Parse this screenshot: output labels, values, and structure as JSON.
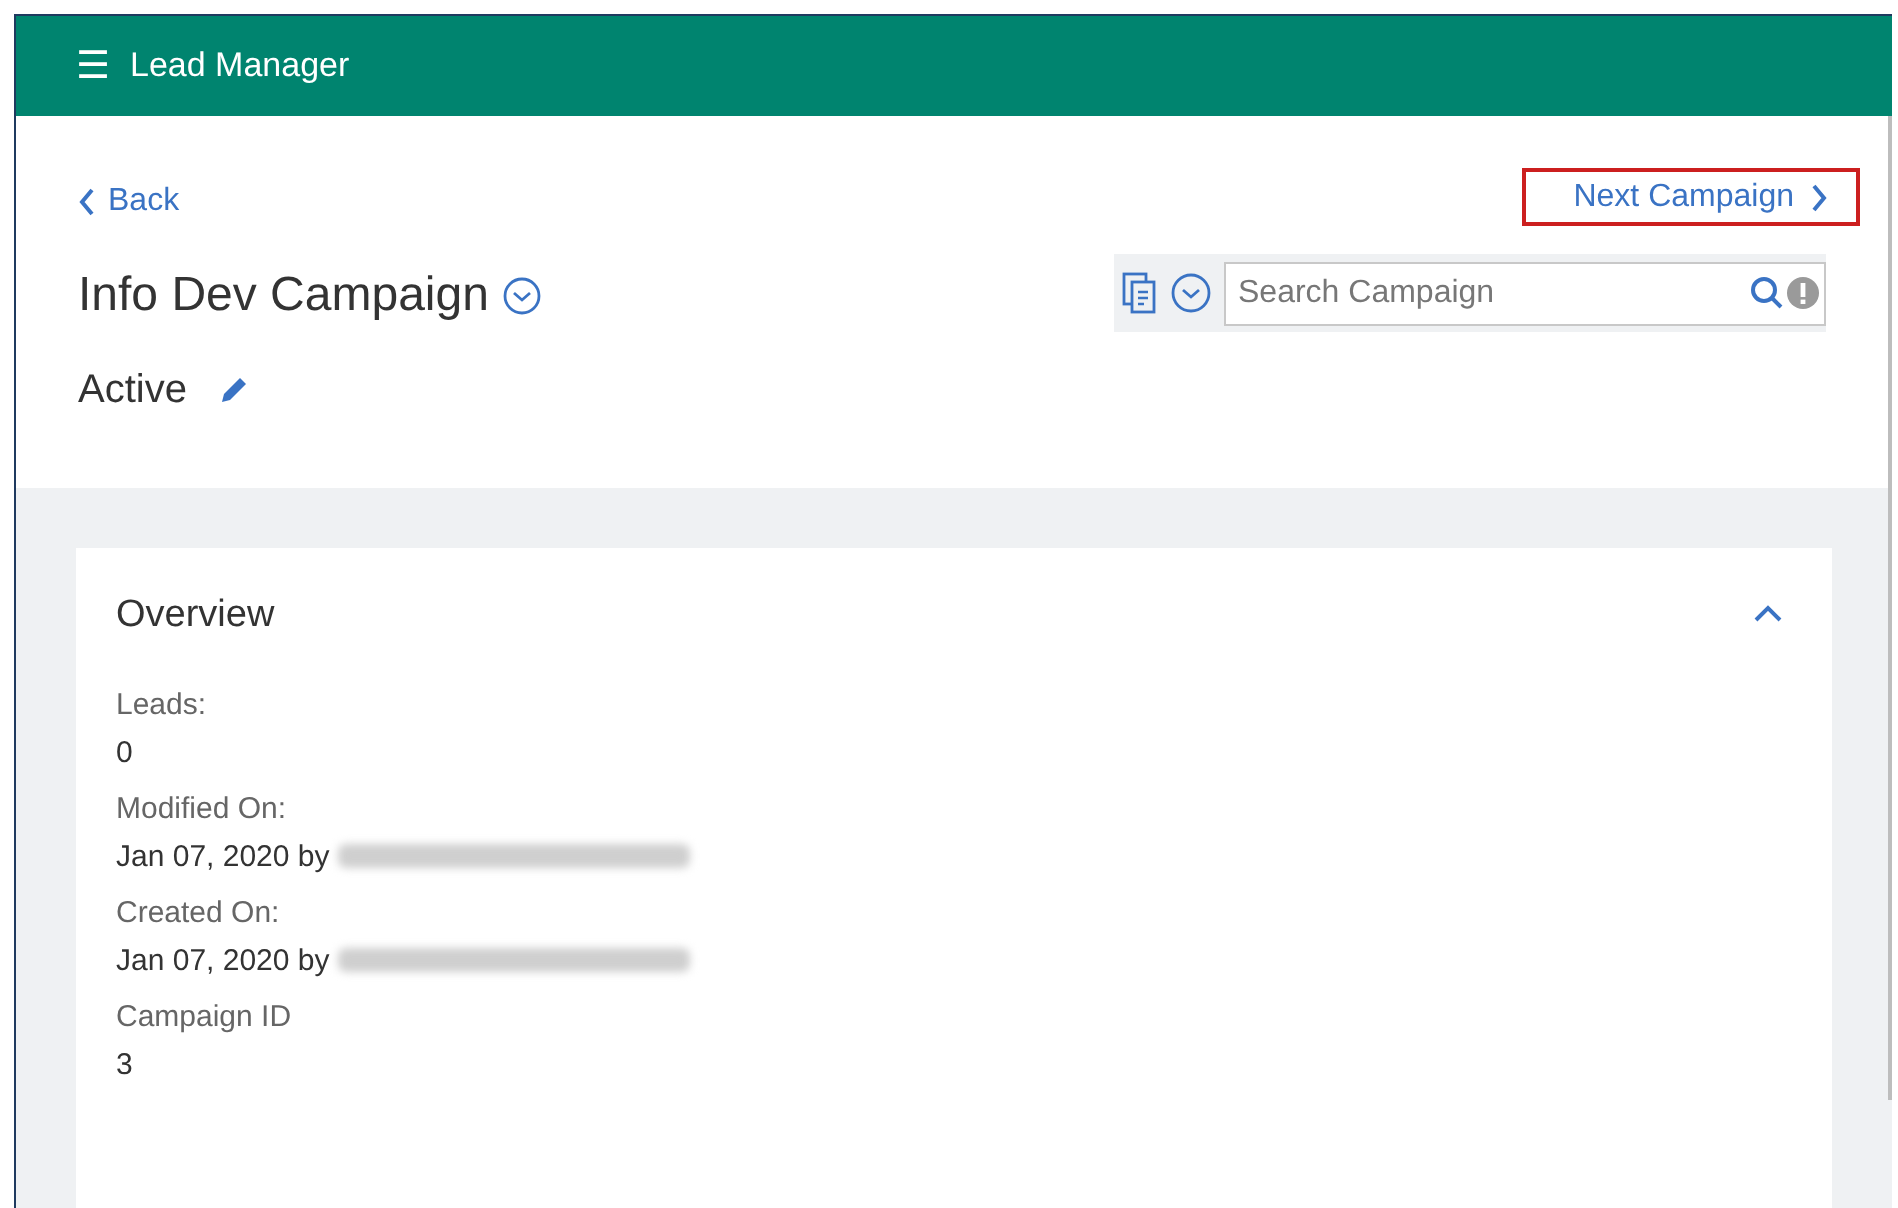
{
  "app_bar": {
    "menu_icon": "☰",
    "title": "Lead Manager"
  },
  "nav": {
    "back": "Back",
    "next": {
      "label": "Next Campaign",
      "highlighted": true
    }
  },
  "campaign": {
    "title": "Info Dev Campaign",
    "status": "Active"
  },
  "search": {
    "placeholder": "Search Campaign"
  },
  "overview": {
    "title": "Overview",
    "expanded": true,
    "fields": [
      {
        "label": "Leads:",
        "value": "0",
        "redacted": false
      },
      {
        "label": "Modified On:",
        "value": "Jan 07, 2020 by",
        "redacted": true
      },
      {
        "label": "Created On:",
        "value": "Jan 07, 2020 by",
        "redacted": true
      },
      {
        "label": "Campaign ID",
        "value": "3",
        "redacted": false
      }
    ]
  }
}
